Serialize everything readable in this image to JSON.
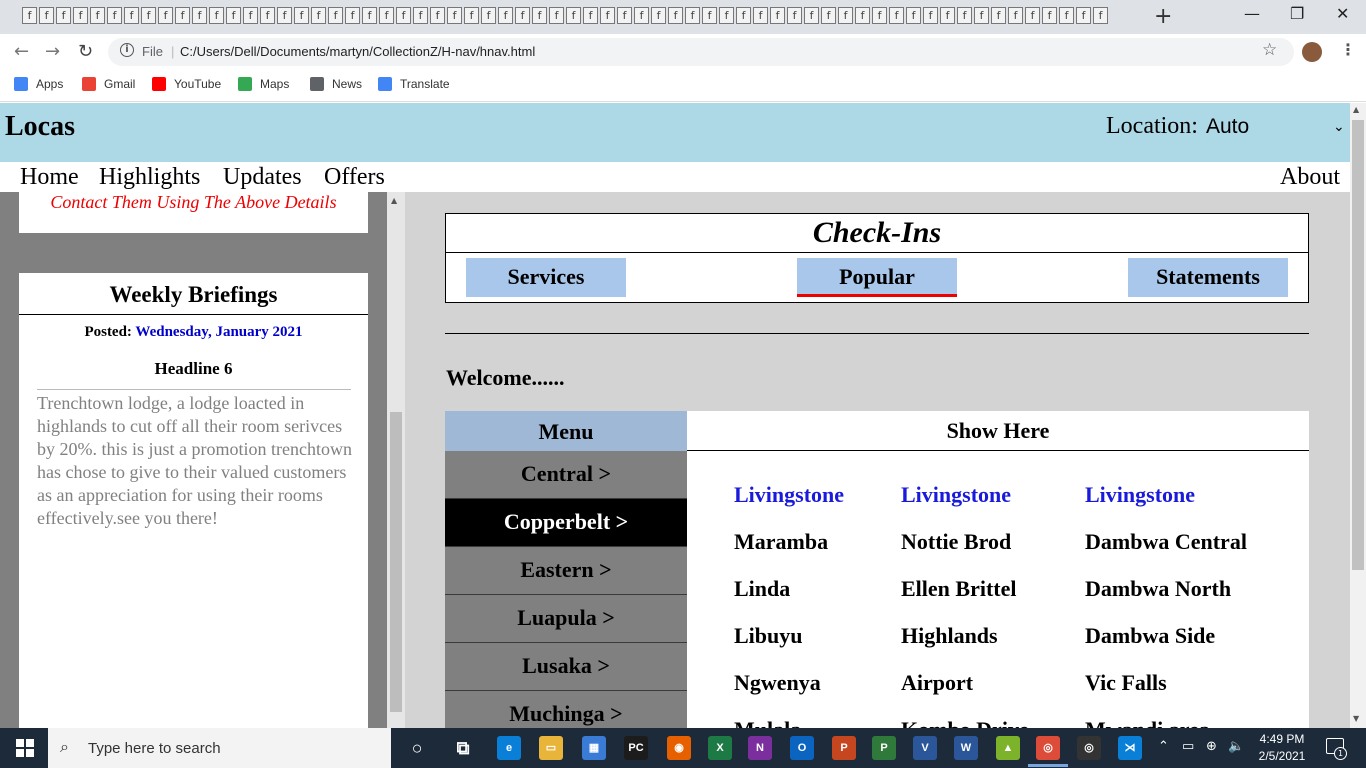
{
  "browser": {
    "tab_favicon_glyph": "f",
    "new_tab_glyph": "+",
    "window": {
      "minimize": "—",
      "maximize": "❐",
      "close": "✕"
    },
    "nav": {
      "back": "←",
      "forward": "→",
      "reload": "↻"
    },
    "address": {
      "scheme": "File",
      "url": "C:/Users/Dell/Documents/martyn/CollectionZ/H-nav/hnav.html"
    },
    "bookmarks": [
      {
        "label": "Apps",
        "icon": "apps-grid-icon",
        "color": "#4285f4"
      },
      {
        "label": "Gmail",
        "icon": "gmail-icon",
        "color": "#ea4335"
      },
      {
        "label": "YouTube",
        "icon": "youtube-icon",
        "color": "#ff0000"
      },
      {
        "label": "Maps",
        "icon": "maps-icon",
        "color": "#34a853"
      },
      {
        "label": "News",
        "icon": "news-icon",
        "color": "#5f6368"
      },
      {
        "label": "Translate",
        "icon": "translate-icon",
        "color": "#4285f4"
      }
    ]
  },
  "site": {
    "brand": "Locas",
    "location_label": "Location:",
    "location_value": "Auto",
    "nav_links": [
      "Home",
      "Highlights",
      "Updates",
      "Offers"
    ],
    "about": "About"
  },
  "sidebar": {
    "contact_note": "Contact Them Using The Above Details",
    "briefing": {
      "title": "Weekly Briefings",
      "posted_label": "Posted:",
      "posted_date": "Wednesday, January 2021",
      "headline": "Headline 6",
      "body": "Trenchtown lodge, a lodge loacted in highlands to cut off all their room serivces by 20%. this is just a promotion trenchtown has chose to give to their valued customers as an appreciation for using their rooms effectively.see you there!"
    }
  },
  "main": {
    "checkins_title": "Check-Ins",
    "tabs": [
      {
        "label": "Services",
        "active": false
      },
      {
        "label": "Popular",
        "active": true
      },
      {
        "label": "Statements",
        "active": false
      }
    ],
    "welcome": "Welcome......",
    "menu_title": "Menu",
    "menu_items": [
      {
        "label": "Central >",
        "active": false
      },
      {
        "label": "Copperbelt >",
        "active": true
      },
      {
        "label": "Eastern >",
        "active": false
      },
      {
        "label": "Luapula >",
        "active": false
      },
      {
        "label": "Lusaka >",
        "active": false
      },
      {
        "label": "Muchinga >",
        "active": false
      }
    ],
    "show_title": "Show Here",
    "columns": [
      {
        "header": "Livingstone",
        "items": [
          "Maramba",
          "Linda",
          "Libuyu",
          "Ngwenya",
          "Mulala"
        ]
      },
      {
        "header": "Livingstone",
        "items": [
          "Nottie Brod",
          "Ellen Brittel",
          "Highlands",
          "Airport",
          "Kombo Drive"
        ]
      },
      {
        "header": "Livingstone",
        "items": [
          "Dambwa Central",
          "Dambwa North",
          "Dambwa Side",
          "Vic Falls",
          "Mwandi area"
        ]
      }
    ]
  },
  "taskbar": {
    "search_placeholder": "Type here to search",
    "time": "4:49 PM",
    "date": "2/5/2021",
    "notification_count": "1",
    "apps": [
      {
        "name": "cortana-icon",
        "label": "○",
        "color": "transparent"
      },
      {
        "name": "task-view-icon",
        "label": "⧉",
        "color": "transparent"
      },
      {
        "name": "edge-icon",
        "label": "e",
        "color": "#0a7fd8"
      },
      {
        "name": "file-explorer-icon",
        "label": "▭",
        "color": "#e8b43a"
      },
      {
        "name": "store-icon",
        "label": "▦",
        "color": "#3a7bd5"
      },
      {
        "name": "pycharm-icon",
        "label": "PC",
        "color": "#1c1c1c"
      },
      {
        "name": "firefox-icon",
        "label": "◉",
        "color": "#e66000"
      },
      {
        "name": "excel-icon",
        "label": "X",
        "color": "#1d7a45"
      },
      {
        "name": "onenote-icon",
        "label": "N",
        "color": "#7b2f9e"
      },
      {
        "name": "outlook-icon",
        "label": "O",
        "color": "#0a64c0"
      },
      {
        "name": "powerpoint-icon",
        "label": "P",
        "color": "#c6461f"
      },
      {
        "name": "project-icon",
        "label": "P",
        "color": "#2f7a3a"
      },
      {
        "name": "visio-icon",
        "label": "V",
        "color": "#2b579a"
      },
      {
        "name": "word-icon",
        "label": "W",
        "color": "#2b579a"
      },
      {
        "name": "bluestacks-icon",
        "label": "▲",
        "color": "#7cb32a"
      },
      {
        "name": "chrome-icon",
        "label": "◎",
        "color": "#dd4b39"
      },
      {
        "name": "settings-app-icon",
        "label": "◎",
        "color": "#333"
      },
      {
        "name": "vscode-icon",
        "label": "⋊",
        "color": "#0a7fd8"
      }
    ],
    "tray": [
      "⌃",
      "▭",
      "⊕",
      "🔈"
    ]
  }
}
